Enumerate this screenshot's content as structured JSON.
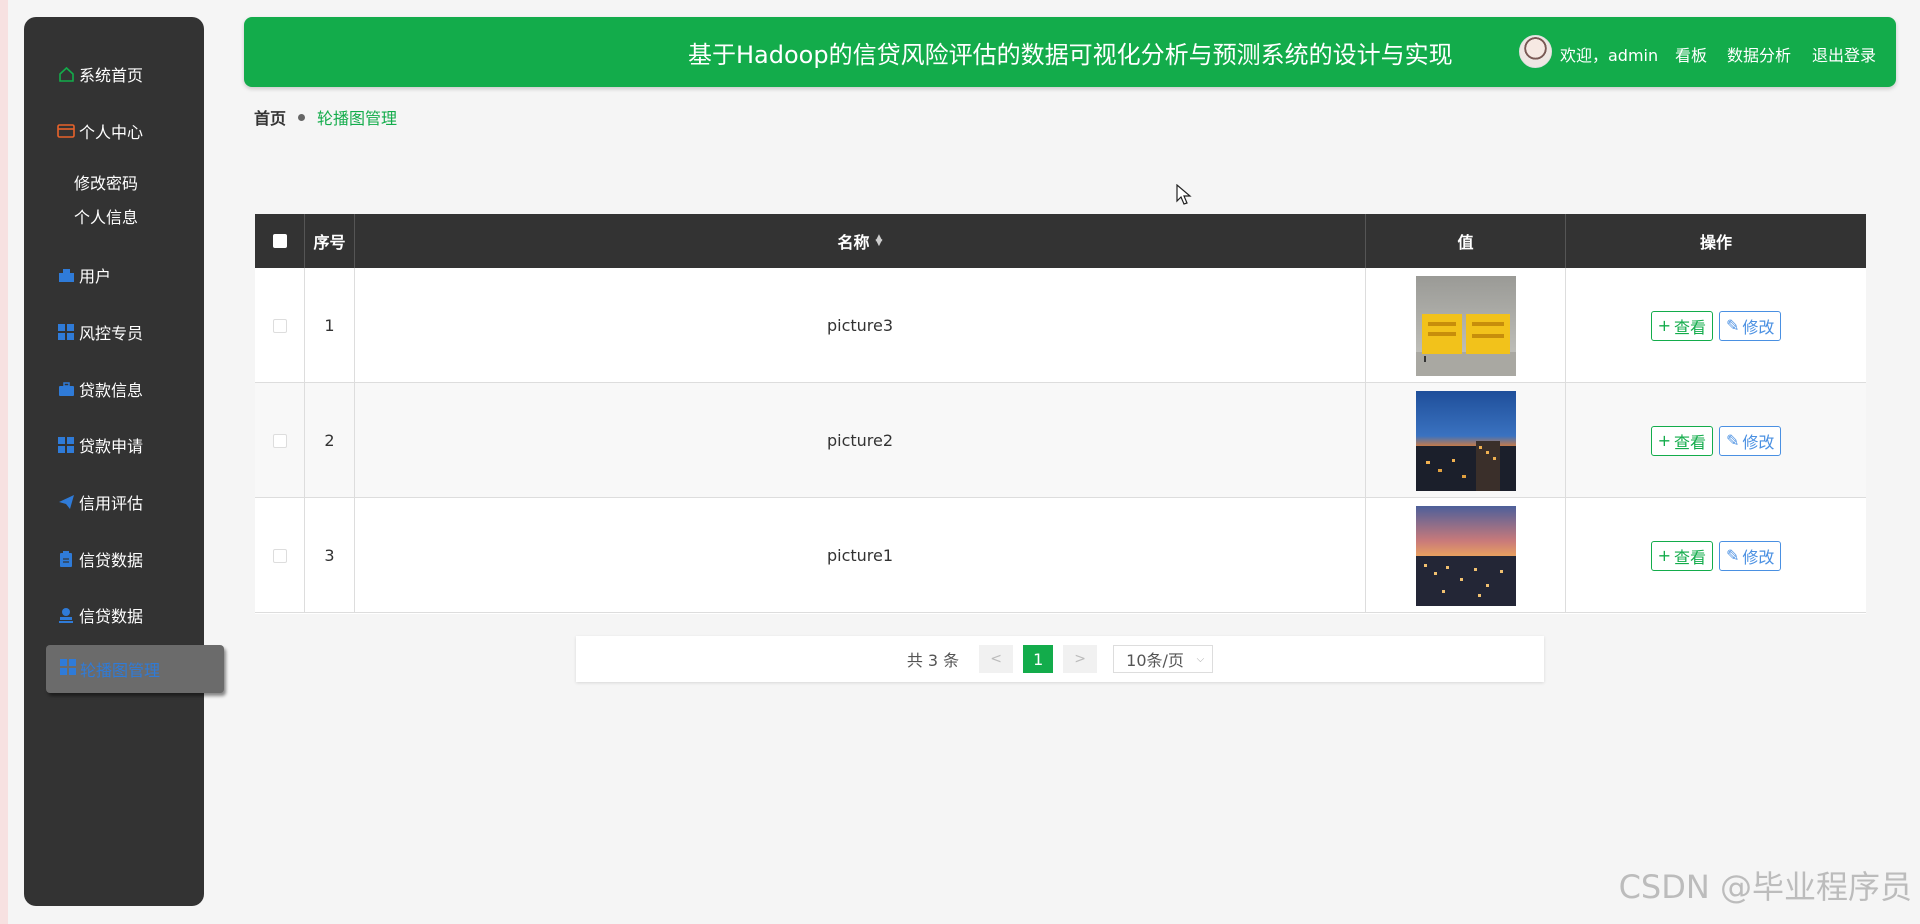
{
  "header": {
    "title": "基于Hadoop的信贷风险评估的数据可视化分析与预测系统的设计与实现",
    "welcome": "欢迎，admin",
    "links": [
      "看板",
      "数据分析",
      "退出登录"
    ],
    "bg_color": "#13ac4b"
  },
  "sidebar": {
    "items": [
      {
        "label": "系统首页",
        "icon": "home-icon",
        "color": "#13ac4b"
      },
      {
        "label": "个人中心",
        "icon": "wallet-icon",
        "color": "#e8632b"
      },
      {
        "label": "用户",
        "icon": "user-card-icon",
        "color": "#2f7bd8"
      },
      {
        "label": "风控专员",
        "icon": "grid-icon",
        "color": "#2f7bd8"
      },
      {
        "label": "贷款信息",
        "icon": "briefcase-icon",
        "color": "#2f7bd8"
      },
      {
        "label": "贷款申请",
        "icon": "grid-icon",
        "color": "#2f7bd8"
      },
      {
        "label": "信用评估",
        "icon": "send-icon",
        "color": "#2f7bd8"
      },
      {
        "label": "信贷数据",
        "icon": "clipboard-icon",
        "color": "#2f7bd8"
      },
      {
        "label": "信贷数据",
        "icon": "stamp-icon",
        "color": "#2f7bd8"
      }
    ],
    "sub_items": [
      "修改密码",
      "个人信息"
    ],
    "active_item": {
      "label": "轮播图管理",
      "icon": "grid-icon",
      "color": "#2f7bd8"
    }
  },
  "breadcrumb": {
    "home": "首页",
    "current": "轮播图管理"
  },
  "table": {
    "headers": {
      "index": "序号",
      "name": "名称",
      "value": "值",
      "actions": "操作"
    },
    "rows": [
      {
        "index": "1",
        "name": "picture3",
        "image": "loan-text-image"
      },
      {
        "index": "2",
        "name": "picture2",
        "image": "city-night-image"
      },
      {
        "index": "3",
        "name": "picture1",
        "image": "city-dusk-image"
      }
    ],
    "view_label": "查看",
    "edit_label": "修改"
  },
  "pagination": {
    "total": "共 3 条",
    "prev": "<",
    "page": "1",
    "next": ">",
    "page_size": "10条/页"
  },
  "watermark": "CSDN @毕业程序员"
}
